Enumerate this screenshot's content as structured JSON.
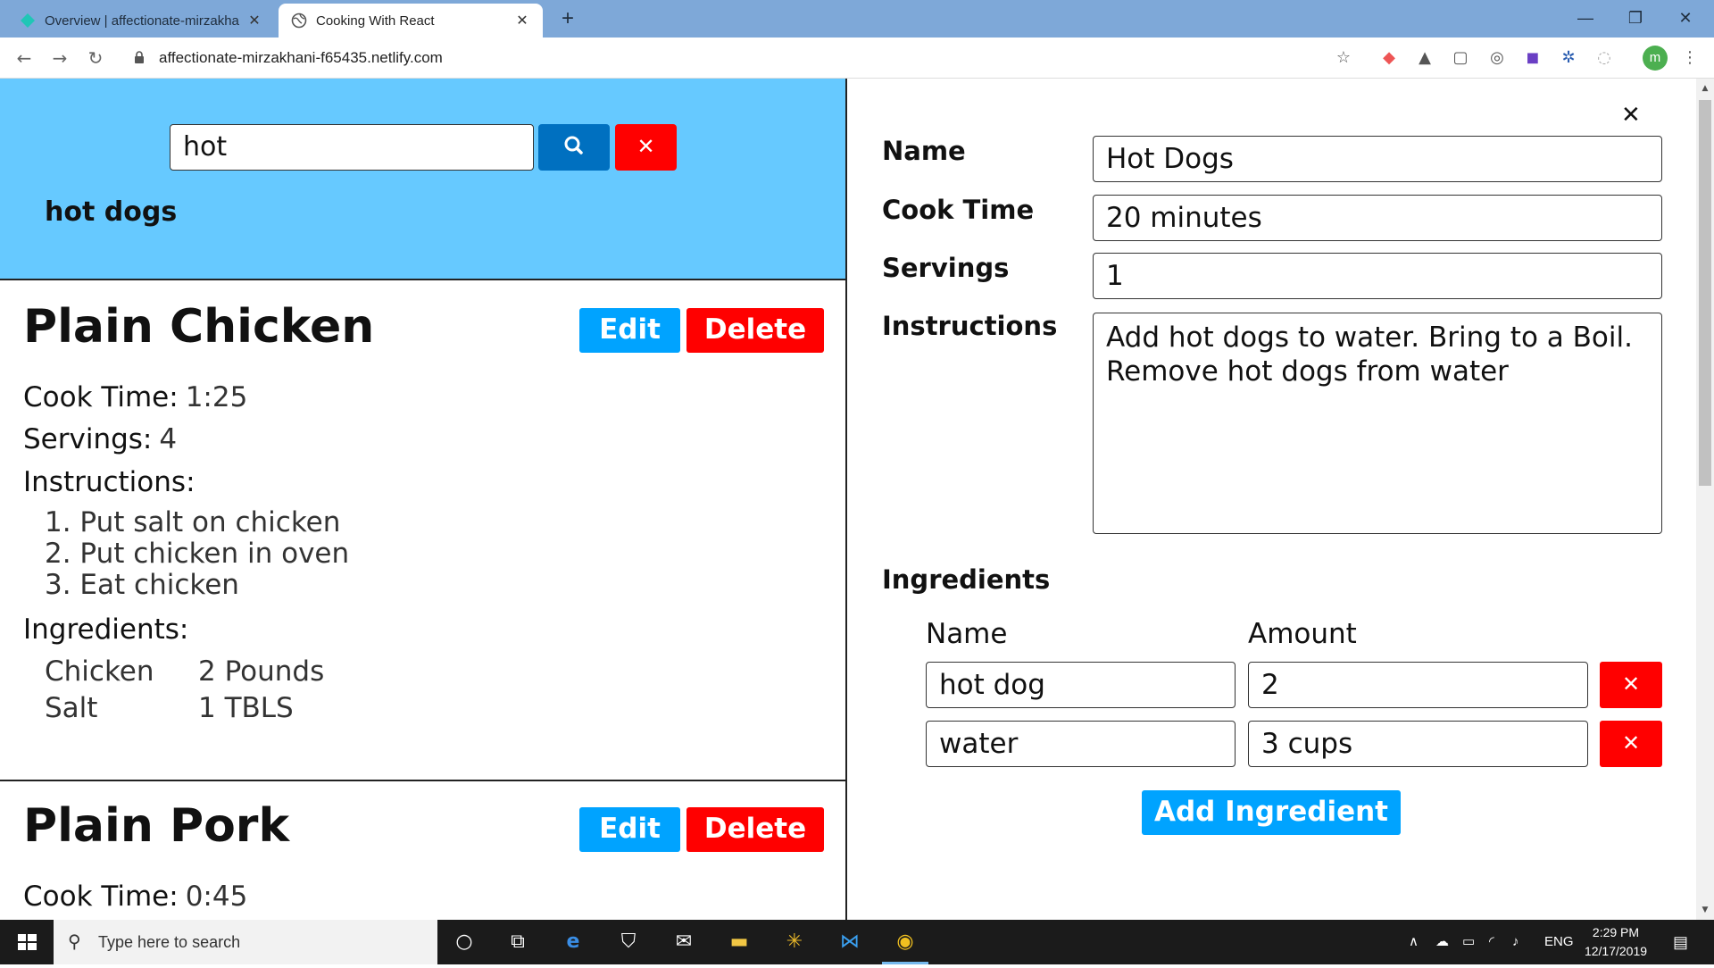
{
  "browser": {
    "tabs": [
      {
        "title": "Overview | affectionate-mirzakha"
      },
      {
        "title": "Cooking With React"
      }
    ],
    "url": "affectionate-mirzakhani-f65435.netlify.com",
    "profile_initial": "m"
  },
  "search": {
    "value": "hot",
    "result": "hot dogs"
  },
  "recipes": [
    {
      "title": "Plain Chicken",
      "edit_label": "Edit",
      "delete_label": "Delete",
      "cook_time_label": "Cook Time:",
      "cook_time": "1:25",
      "servings_label": "Servings:",
      "servings": "4",
      "instructions_label": "Instructions:",
      "instructions": [
        "1. Put salt on chicken",
        "2. Put chicken in oven",
        "3. Eat chicken"
      ],
      "ingredients_label": "Ingredients:",
      "ingredients": [
        {
          "name": "Chicken",
          "amount": "2 Pounds"
        },
        {
          "name": "Salt",
          "amount": "1 TBLS"
        }
      ]
    },
    {
      "title": "Plain Pork",
      "edit_label": "Edit",
      "delete_label": "Delete",
      "cook_time_label": "Cook Time:",
      "cook_time": "0:45"
    }
  ],
  "editor": {
    "name_label": "Name",
    "name": "Hot Dogs",
    "cook_time_label": "Cook Time",
    "cook_time": "20 minutes",
    "servings_label": "Servings",
    "servings": "1",
    "instructions_label": "Instructions",
    "instructions": "Add hot dogs to water. Bring to a Boil. Remove hot dogs from water",
    "ingredients_label": "Ingredients",
    "ing_name_header": "Name",
    "ing_amount_header": "Amount",
    "ingredients": [
      {
        "name": "hot dog",
        "amount": "2"
      },
      {
        "name": "water",
        "amount": "3 cups"
      }
    ],
    "add_label": "Add Ingredient"
  },
  "taskbar": {
    "search_placeholder": "Type here to search",
    "lang": "ENG",
    "time": "2:29 PM",
    "date": "12/17/2019"
  },
  "colors": {
    "search_bg": "#66c9ff",
    "primary": "#00a3ff",
    "danger": "#ff0000",
    "search_btn": "#0070c0"
  }
}
